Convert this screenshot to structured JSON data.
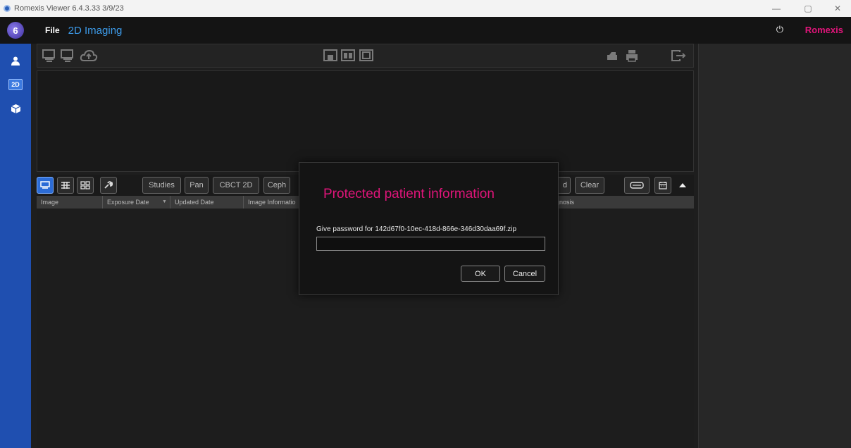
{
  "window": {
    "title": "Romexis Viewer 6.4.3.33 3/9/23",
    "controls": {
      "minimize": "—",
      "restore": "▢",
      "close": "✕"
    }
  },
  "header": {
    "logo_letter": "6",
    "menu_file": "File",
    "section_title": "2D Imaging",
    "power_icon": "⏻",
    "brand": "Romexis"
  },
  "sidebar": {
    "items": [
      {
        "icon": "person-icon",
        "glyph": "👤"
      },
      {
        "icon": "2d-imaging-icon",
        "label": "2D"
      },
      {
        "icon": "3d-cube-icon",
        "glyph": "⬢"
      }
    ]
  },
  "toolbar": {
    "left_icons": [
      "import-device-icon",
      "export-device-icon",
      "cloud-upload-icon"
    ],
    "center_icons": [
      "layout-single-icon",
      "layout-grid-icon",
      "layout-image-icon"
    ],
    "right_icons": [
      "scanner-icon",
      "printer-icon",
      "export-icon"
    ]
  },
  "filterbar": {
    "view_icons": [
      "thumbnail-view-icon",
      "list-view-icon",
      "grid-view-icon",
      "wrench-icon"
    ],
    "tabs": [
      "Studies",
      "Pan",
      "CBCT 2D",
      "Ceph"
    ],
    "partial_tab": "d",
    "clear_label": "Clear",
    "right_icons": [
      "dental-arch-icon",
      "calendar-icon",
      "collapse-up-icon"
    ]
  },
  "table": {
    "columns": [
      "Image",
      "Exposure Date",
      "Updated Date",
      "Image Informatio",
      "gnosis"
    ],
    "sort_indicator": "▼"
  },
  "dialog": {
    "title": "Protected patient information",
    "label": "Give password for 142d67f0-10ec-418d-866e-346d30daa69f.zip",
    "input_value": "",
    "ok_label": "OK",
    "cancel_label": "Cancel"
  }
}
